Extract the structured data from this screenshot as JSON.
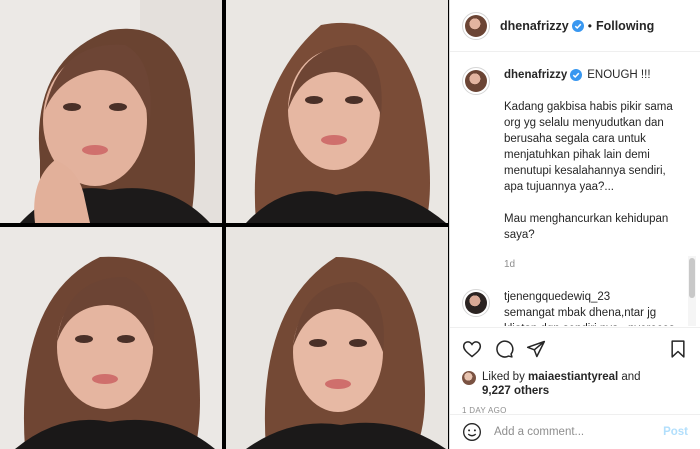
{
  "post": {
    "username": "dhenafrizzy",
    "follow_status": "Following",
    "caption_title": "ENOUGH !!!",
    "caption_body": "Kadang gakbisa habis pikir sama org yg selalu menyudutkan dan berusaha segala cara untuk menjatuhkan pihak lain demi menutupi kesalahannya sendiri, apa tujuannya yaa?...\n\nMau menghancurkan kehidupan saya?",
    "caption_time": "1d",
    "comment_user": "tjenengquedewiq_23",
    "comment_text": "semangat mbak dhena,ntar jg kliatan dgn sendiri nya...nyerocos trs kok gk capek yaa mulutnya..dgn",
    "liked_prefix": "Liked by",
    "liked_user": "maiaestiantyreal",
    "liked_and": "and",
    "liked_count": "9,227 others",
    "date": "1 DAY AGO",
    "comment_placeholder": "Add a comment...",
    "post_button": "Post"
  },
  "icons": [
    "heart-icon",
    "comment-icon",
    "share-icon",
    "bookmark-icon",
    "emoji-icon",
    "verified-icon"
  ],
  "colors": {
    "verified": "#3897f0",
    "post_disabled": "#b2dffc",
    "muted": "#8e8e8e",
    "text": "#262626"
  }
}
